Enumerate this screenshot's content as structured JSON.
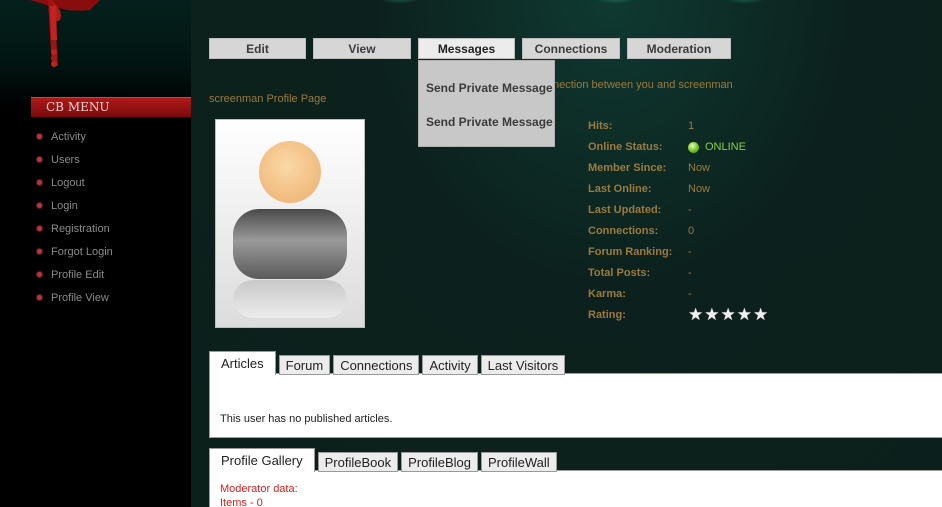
{
  "left_menu": {
    "header": "CB MENU",
    "items": [
      "Activity",
      "Users",
      "Logout",
      "Login",
      "Registration",
      "Forgot Login",
      "Profile Edit",
      "Profile View"
    ]
  },
  "top_nav": {
    "tabs": [
      "Edit",
      "View",
      "Messages",
      "Connections",
      "Moderation"
    ],
    "active": "Messages"
  },
  "messages_dropdown": {
    "items": [
      "Send Private Message",
      "Send Private Message"
    ]
  },
  "connection_text": "nection between you and screenman",
  "profile_title": "screenman Profile Page",
  "stats": [
    {
      "label": "Hits:",
      "value": "1"
    },
    {
      "label": "Online Status:",
      "value": "ONLINE"
    },
    {
      "label": "Member Since:",
      "value": "Now"
    },
    {
      "label": "Last Online:",
      "value": "Now"
    },
    {
      "label": "Last Updated:",
      "value": "-"
    },
    {
      "label": "Connections:",
      "value": "0"
    },
    {
      "label": "Forum Ranking:",
      "value": "-"
    },
    {
      "label": "Total Posts:",
      "value": "-"
    },
    {
      "label": "Karma:",
      "value": "-"
    },
    {
      "label": "Rating:",
      "value": ""
    }
  ],
  "rating_stars": 5,
  "tab_panel_1": {
    "tabs": [
      "Articles",
      "Forum",
      "Connections",
      "Activity",
      "Last Visitors"
    ],
    "active": "Articles",
    "content": "This user has no published articles."
  },
  "tab_panel_2": {
    "tabs": [
      "Profile Gallery",
      "ProfileBook",
      "ProfileBlog",
      "ProfileWall"
    ],
    "active": "Profile Gallery",
    "moderator_label": "Moderator data:",
    "items_label": "Items - 0"
  },
  "colors": {
    "accent_gold": "#9a7a3e",
    "menu_red": "#b01818",
    "online_green": "#8bcf3a",
    "moderator_red": "#d42020"
  }
}
